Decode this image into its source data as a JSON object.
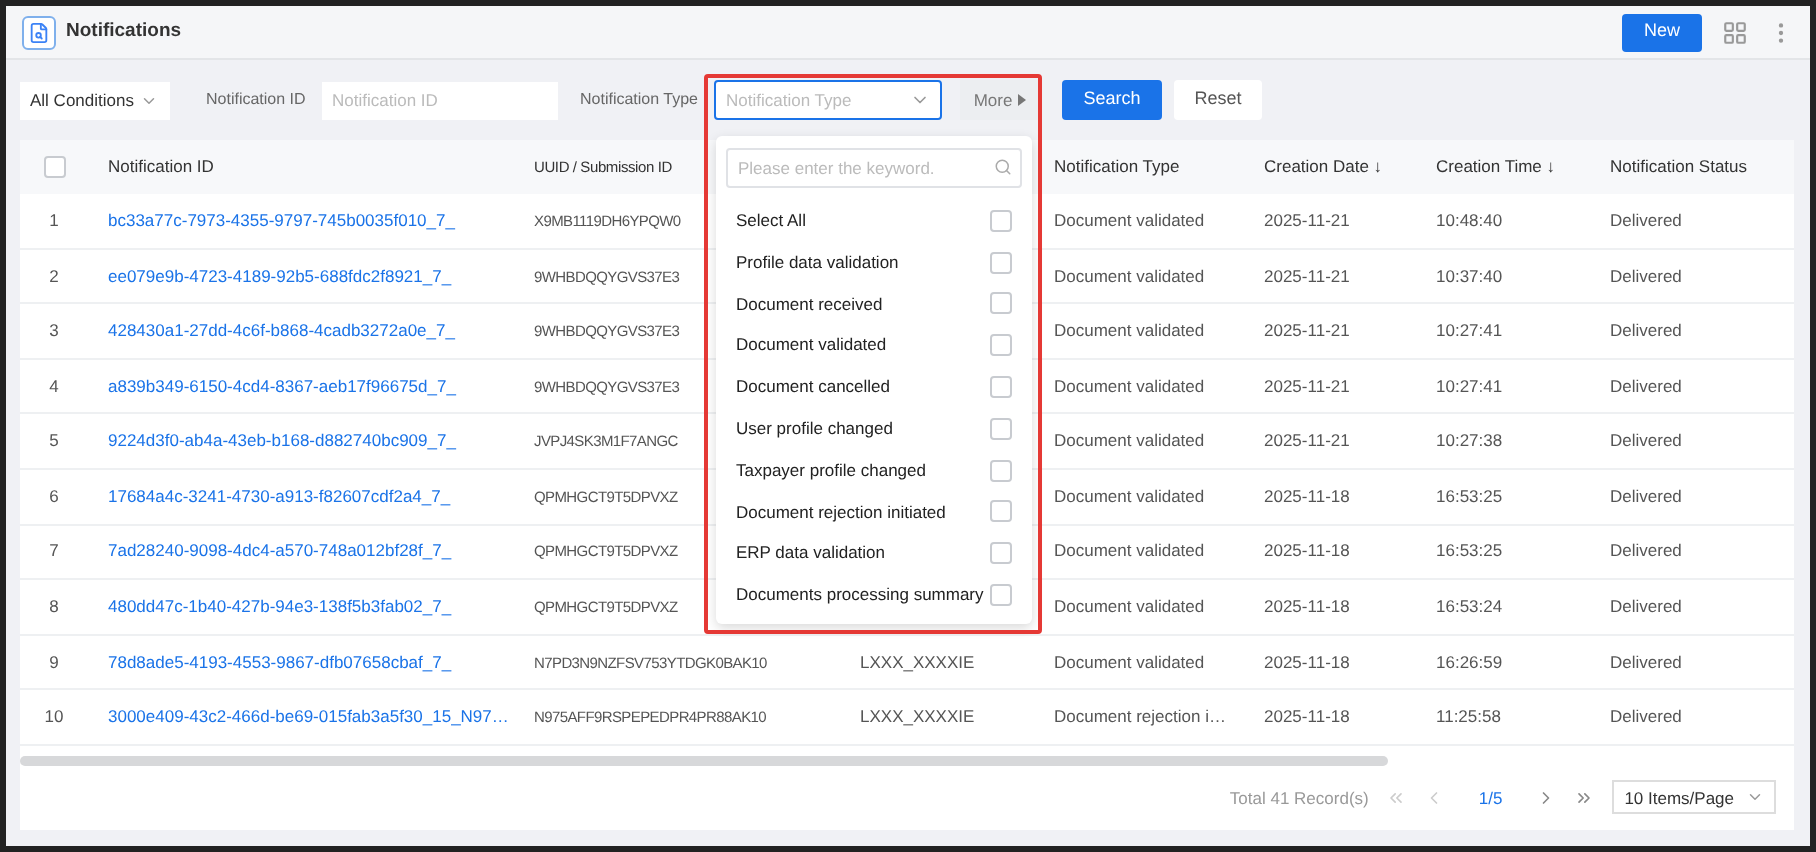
{
  "header": {
    "title": "Notifications",
    "new_button": "New"
  },
  "filters": {
    "conditions": "All Conditions",
    "id_label": "Notification ID",
    "id_placeholder": "Notification ID",
    "type_label": "Notification Type",
    "type_placeholder": "Notification Type",
    "more": "More",
    "search": "Search",
    "reset": "Reset"
  },
  "dropdown": {
    "search_placeholder": "Please enter the keyword.",
    "options": [
      {
        "label": "Select All",
        "checked": false
      },
      {
        "label": "Profile data validation",
        "checked": false
      },
      {
        "label": "Document received",
        "checked": false
      },
      {
        "label": "Document validated",
        "checked": false
      },
      {
        "label": "Document cancelled",
        "checked": false
      },
      {
        "label": "User profile changed",
        "checked": false
      },
      {
        "label": "Taxpayer profile changed",
        "checked": false
      },
      {
        "label": "Document rejection initiated",
        "checked": false
      },
      {
        "label": "ERP data validation",
        "checked": false
      },
      {
        "label": "Documents processing summary",
        "checked": false
      }
    ]
  },
  "table": {
    "select_all_checked": false,
    "columns": [
      "Notification ID",
      "UUID / Submission ID",
      null,
      "Notification Type",
      "Creation Date ↓",
      "Creation Time ↓",
      "Notification Status"
    ],
    "rows": [
      {
        "index": "1",
        "id": "bc33a77c-7973-4355-9797-745b0035f010_7_",
        "uuid": "X9MB1119DH6YPQW0",
        "type": "Document validated",
        "date": "2025-11-21",
        "time": "10:48:40",
        "status": "Delivered"
      },
      {
        "index": "2",
        "id": "ee079e9b-4723-4189-92b5-688fdc2f8921_7_",
        "uuid": "9WHBDQQYGVS37E3",
        "type": "Document validated",
        "date": "2025-11-21",
        "time": "10:37:40",
        "status": "Delivered"
      },
      {
        "index": "3",
        "id": "428430a1-27dd-4c6f-b868-4cadb3272a0e_7_",
        "uuid": "9WHBDQQYGVS37E3",
        "type": "Document validated",
        "date": "2025-11-21",
        "time": "10:27:41",
        "status": "Delivered"
      },
      {
        "index": "4",
        "id": "a839b349-6150-4cd4-8367-aeb17f96675d_7_",
        "uuid": "9WHBDQQYGVS37E3",
        "type": "Document validated",
        "date": "2025-11-21",
        "time": "10:27:41",
        "status": "Delivered"
      },
      {
        "index": "5",
        "id": "9224d3f0-ab4a-43eb-b168-d882740bc909_7_",
        "uuid": "JVPJ4SK3M1F7ANGC",
        "type": "Document validated",
        "date": "2025-11-21",
        "time": "10:27:38",
        "status": "Delivered"
      },
      {
        "index": "6",
        "id": "17684a4c-3241-4730-a913-f82607cdf2a4_7_",
        "uuid": "QPMHGCT9T5DPVXZ",
        "type": "Document validated",
        "date": "2025-11-18",
        "time": "16:53:25",
        "status": "Delivered"
      },
      {
        "index": "7",
        "id": "7ad28240-9098-4dc4-a570-748a012bf28f_7_",
        "uuid": "QPMHGCT9T5DPVXZ",
        "type": "Document validated",
        "date": "2025-11-18",
        "time": "16:53:25",
        "status": "Delivered"
      },
      {
        "index": "8",
        "id": "480dd47c-1b40-427b-94e3-138f5b3fab02_7_",
        "uuid": "QPMHGCT9T5DPVXZ",
        "type": "Document validated",
        "date": "2025-11-18",
        "time": "16:53:24",
        "status": "Delivered"
      },
      {
        "index": "9",
        "id": "78d8ade5-4193-4553-9867-dfb07658cbaf_7_",
        "uuid": "N7PD3N9NZFSV753YTDGK0BAK10",
        "column_3": "LXXX_XXXXIE",
        "type": "Document validated",
        "date": "2025-11-18",
        "time": "16:26:59",
        "status": "Delivered"
      },
      {
        "index": "10",
        "id": "3000e409-43c2-466d-be69-015fab3a5f30_15_N97…",
        "uuid": "N975AFF9RSPEPEDPR4PR88AK10",
        "column_3": "LXXX_XXXXIE",
        "type": "Document rejection i…",
        "date": "2025-11-18",
        "time": "11:25:58",
        "status": "Delivered"
      }
    ]
  },
  "pagination": {
    "total": "Total 41 Record(s)",
    "page": "1/5",
    "page_size": "10 Items/Page"
  }
}
